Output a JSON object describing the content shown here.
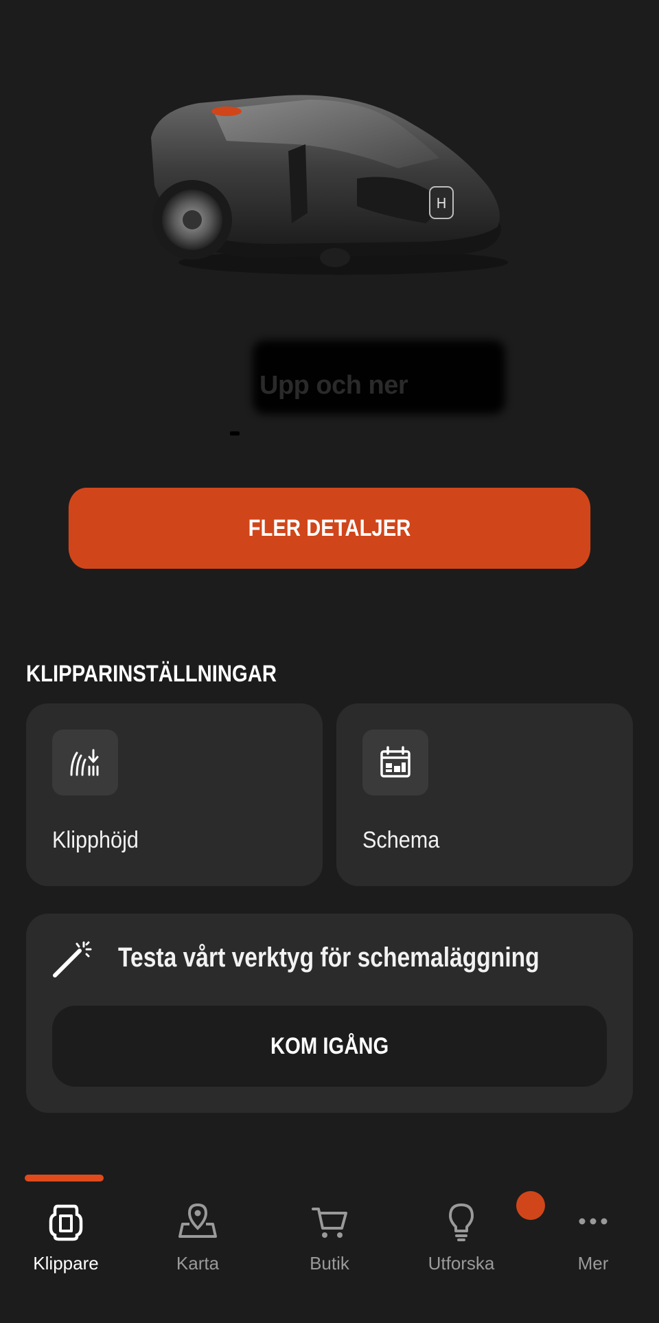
{
  "hero": {
    "status_text": "Upp och ner"
  },
  "primary_action": {
    "label": "FLER DETALJER"
  },
  "settings_section": {
    "title": "KLIPPARINSTÄLLNINGAR",
    "tiles": [
      {
        "label": "Klipphöjd",
        "icon": "cutting-height-icon"
      },
      {
        "label": "Schema",
        "icon": "calendar-icon"
      }
    ]
  },
  "promo": {
    "title": "Testa vårt verktyg för schemaläggning",
    "icon": "magic-wand-icon",
    "button_label": "KOM IGÅNG"
  },
  "tabbar": {
    "items": [
      {
        "label": "Klippare",
        "icon": "mower-icon",
        "active": true
      },
      {
        "label": "Karta",
        "icon": "map-pin-icon",
        "active": false
      },
      {
        "label": "Butik",
        "icon": "cart-icon",
        "active": false
      },
      {
        "label": "Utforska",
        "icon": "lightbulb-icon",
        "active": false,
        "badge": true
      },
      {
        "label": "Mer",
        "icon": "more-icon",
        "active": false
      }
    ]
  },
  "colors": {
    "background": "#1c1c1c",
    "accent": "#d0461a",
    "card": "#2b2b2b",
    "icon_tile": "#3a3a3a",
    "tab_inactive": "#9a9a9a"
  }
}
